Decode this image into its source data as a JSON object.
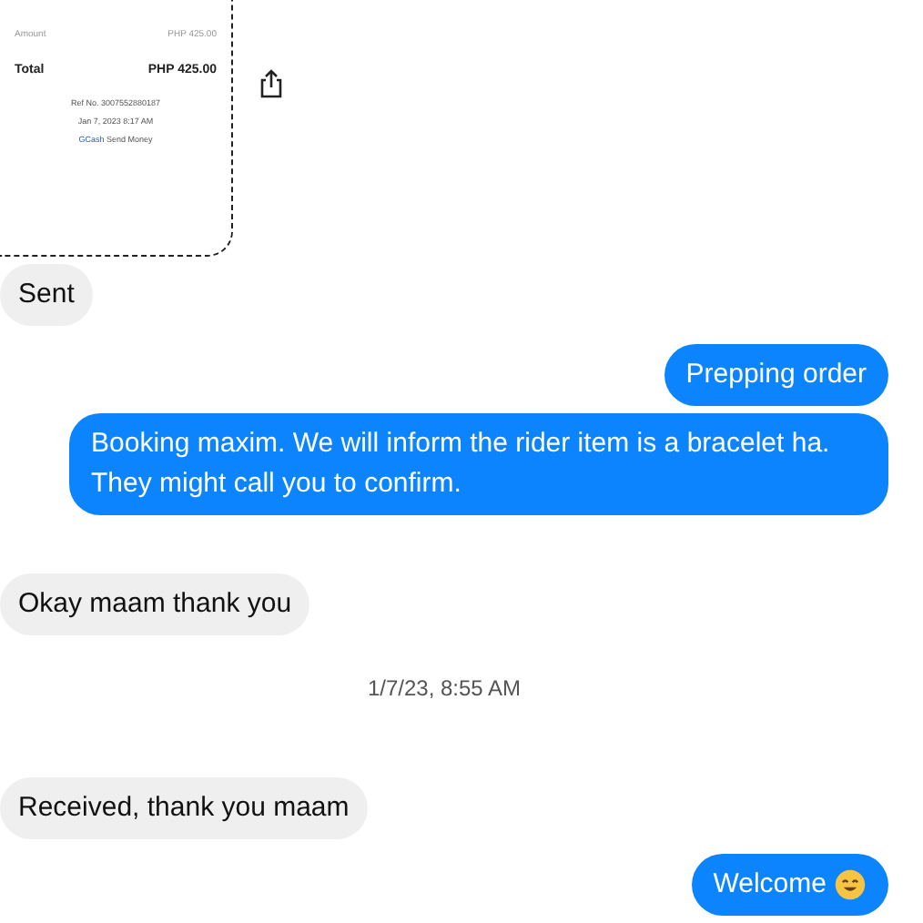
{
  "receipt": {
    "amount_label": "Amount",
    "amount_value": "PHP 425.00",
    "total_label": "Total",
    "total_value": "PHP 425.00",
    "ref": "Ref No. 3007552880187",
    "date": "Jan 7, 2023 8:17 AM",
    "brand": "GCash",
    "service": "Send Money"
  },
  "messages": [
    {
      "kind": "received",
      "text": "Sent"
    },
    {
      "kind": "sent",
      "text": "Prepping order"
    },
    {
      "kind": "sent",
      "text": "Booking maxim. We will inform the rider item is a bracelet ha. They might call you to confirm."
    },
    {
      "kind": "received",
      "text": "Okay maam thank you"
    },
    {
      "kind": "timestamp",
      "text": "1/7/23, 8:55 AM"
    },
    {
      "kind": "received",
      "text": "Received, thank you maam"
    },
    {
      "kind": "sent",
      "text": "Welcome",
      "emoji": true
    }
  ]
}
